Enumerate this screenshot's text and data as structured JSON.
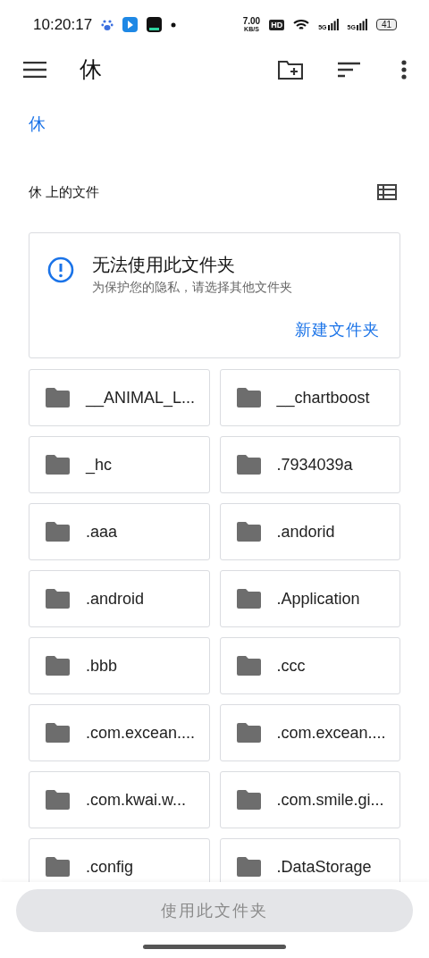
{
  "status_bar": {
    "time": "10:20:17",
    "speed": "7.00",
    "speed_unit": "KB/S",
    "hd": "HD",
    "signal_1": "5G",
    "signal_2": "5G",
    "battery": "41"
  },
  "app_bar": {
    "title": "休"
  },
  "breadcrumb": "休",
  "section_title": "休 上的文件",
  "notice": {
    "title": "无法使用此文件夹",
    "message": "为保护您的隐私，请选择其他文件夹",
    "action": "新建文件夹"
  },
  "folders": [
    {
      "name": "__ANIMAL_L..."
    },
    {
      "name": "__chartboost"
    },
    {
      "name": "_hc"
    },
    {
      "name": ".7934039a"
    },
    {
      "name": ".aaa"
    },
    {
      "name": ".andorid"
    },
    {
      "name": ".android"
    },
    {
      "name": ".Application"
    },
    {
      "name": ".bbb"
    },
    {
      "name": ".ccc"
    },
    {
      "name": ".com.excean...."
    },
    {
      "name": ".com.excean...."
    },
    {
      "name": ".com.kwai.w..."
    },
    {
      "name": ".com.smile.gi..."
    },
    {
      "name": ".config"
    },
    {
      "name": ".DataStorage"
    }
  ],
  "confirm_button": {
    "label": "使用此文件夹",
    "disabled": true
  }
}
